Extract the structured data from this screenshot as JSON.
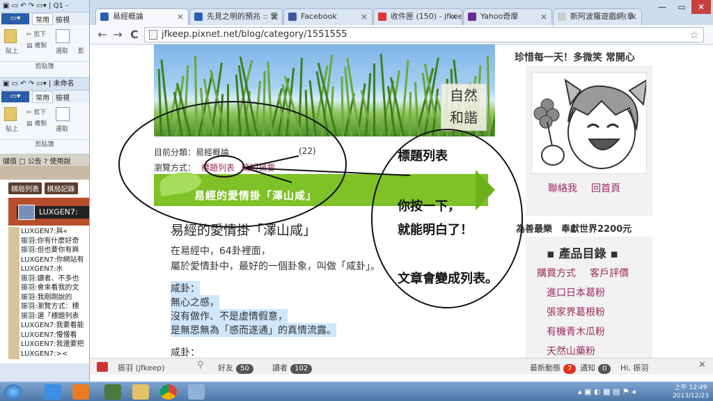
{
  "bg_windows": {
    "win1_title": "Q1 -",
    "win2_title": "未命名",
    "tab_file": "▭▾",
    "tab_home": "常用",
    "tab_view": "檢視",
    "cut": "剪下",
    "copy": "複製",
    "paste": "貼上",
    "select": "選取",
    "image_group": "影",
    "clipboard_group": "剪貼簿",
    "image_group2": "影像"
  },
  "chat": {
    "toolbar": "儲值 □ 公告 ? 使用說",
    "btn1": "棋局列表",
    "btn2": "棋局記錄",
    "user": "LUXGEN7:",
    "lines": [
      "LUXGEN7:與«",
      "振羽:你有什麼好奇",
      "振羽:但也要你有興",
      "LUXGEN7:你網站有",
      "LUXGEN7:水",
      "振羽:讀者、不多也",
      "振羽:會來看我的文",
      "振羽:我剛剛說的",
      "振羽:瀏覽方式：標",
      "振羽:選「標題列表",
      "LUXGEN7:我要看能",
      "LUXGEN7:慢慢看",
      "LUXGEN7:我還要把",
      "LUXGEN7:><"
    ]
  },
  "browser": {
    "tabs": [
      {
        "label": "易經概論",
        "color": "#2a5cb8"
      },
      {
        "label": "先見之明的預兆 :: 雲",
        "color": "#2a5cb8"
      },
      {
        "label": "Facebook",
        "color": "#3b5998"
      },
      {
        "label": "收件匣 (150) - jfkee",
        "color": "#d33"
      },
      {
        "label": "Yahoo奇摩",
        "color": "#6b2c91"
      },
      {
        "label": "新阿波羅遊戲網(拿",
        "color": "#aaa"
      }
    ],
    "url": "jfkeep.pixnet.net/blog/category/1551555",
    "back_icon": "←",
    "forward_icon": "→",
    "reload_icon": "C",
    "star_icon": "☆",
    "menu_icon": "≡"
  },
  "page": {
    "banner_text": "自然\n和諧",
    "category_label": "目前分類：易經概論",
    "category_count": "(22)",
    "browse_label": "瀏覽方式：",
    "browse_link1": "標題列表",
    "browse_link2": "簡短摘要",
    "ribbon_title": "易經的愛情掛「澤山咸」",
    "post_title": "易經的愛情掛「澤山咸」",
    "para1": "在易經中，64卦裡面，",
    "para2": "屬於愛情卦中，最好的一個卦象，叫做「咸卦」。",
    "hl1": "咸卦：",
    "hl2": "無心之感，",
    "hl3": "沒有做作、不是虛情假意，",
    "hl4": "是無思無為「感而遂通」的真情流露。",
    "para3": "咸卦："
  },
  "annotations": {
    "a1": "標題列表",
    "a2": "你按一下，",
    "a3": "就能明白了！",
    "a4": "文章會變成列表。"
  },
  "sidebar": {
    "heading": "珍惜每一天！多微笑 常開心",
    "contact": "聯絡我",
    "home": "回首頁",
    "motto": "為善最樂　奉獻世界2200元",
    "cat_title": "▪ 產品目錄 ▪",
    "buy": "購買方式",
    "review": "客戶評價",
    "items": [
      "進口日本葛粉",
      "張家界葛根粉",
      "有機青木瓜粉",
      "天然山藥粉"
    ]
  },
  "pixbar": {
    "user": "振羽 (jfkeep)",
    "friends_label": "好友",
    "friends_count": "50",
    "readers_label": "讀者",
    "readers_count": "102",
    "news_label": "最新動態",
    "news_count": "7",
    "notify_label": "通知",
    "notify_count": "0",
    "greet": "Hi, 振羽"
  },
  "taskbar": {
    "time": "上午 12:49",
    "date": "2013/12/23"
  }
}
